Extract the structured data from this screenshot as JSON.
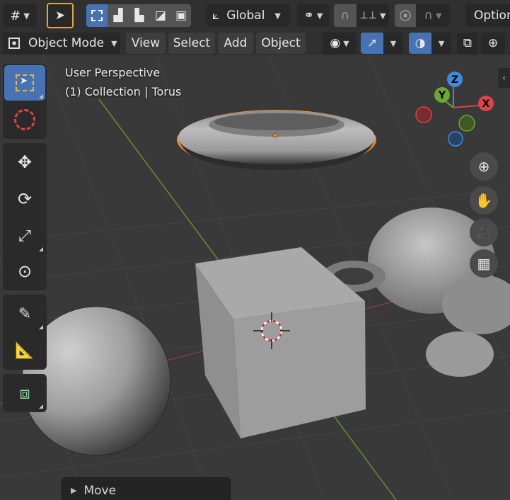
{
  "header": {
    "transform_orientation": "Global",
    "options_label": "Options"
  },
  "menubar": {
    "mode": "Object Mode",
    "menus": [
      "View",
      "Select",
      "Add",
      "Object"
    ]
  },
  "viewport": {
    "perspective_label": "User Perspective",
    "collection_label": "(1) Collection | Torus"
  },
  "gizmo": {
    "x_label": "X",
    "y_label": "Y",
    "z_label": "Z",
    "colors": {
      "x": "#e0414a",
      "y": "#6aa82e",
      "z": "#3b8de0"
    }
  },
  "tools": [
    "select-box",
    "cursor",
    "move",
    "rotate",
    "scale",
    "transform",
    "annotate",
    "measure",
    "add-cube"
  ],
  "operator_panel": {
    "title": "Move"
  },
  "colors": {
    "accent": "#4772b3",
    "selection_outline": "#f28c1e",
    "header_bg": "#303030",
    "viewport_bg": "#393939"
  }
}
